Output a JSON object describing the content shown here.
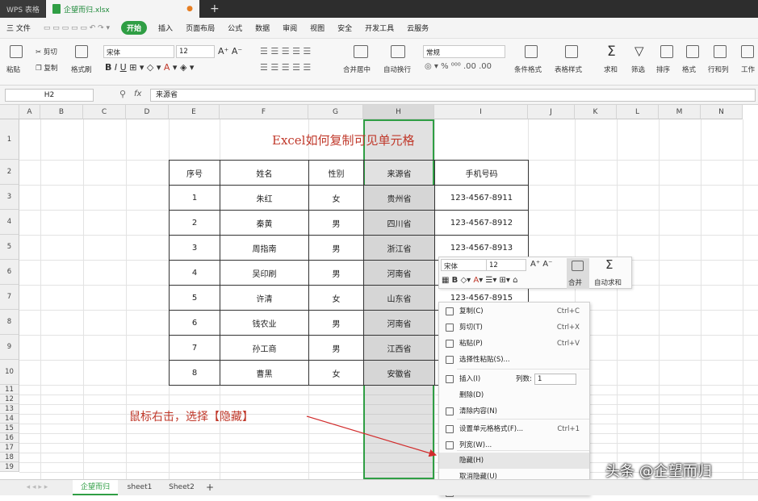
{
  "app": {
    "name": "WPS 表格",
    "file_tab": "企望而归.xlsx",
    "new_tab": "+"
  },
  "menu": {
    "file": "三 文件",
    "start": "开始",
    "items": [
      "插入",
      "页面布局",
      "公式",
      "数据",
      "审阅",
      "视图",
      "安全",
      "开发工具",
      "云服务"
    ]
  },
  "ribbon": {
    "paste": "粘贴",
    "cut": "剪切",
    "copy": "复制",
    "format_painter": "格式刷",
    "font_name": "宋体",
    "font_size": "12",
    "merge": "合并居中",
    "wrap": "自动换行",
    "number_format": "常规",
    "cond_format": "条件格式",
    "table_style": "表格样式",
    "sum": "求和",
    "filter": "筛选",
    "sort": "排序",
    "format": "格式",
    "rowcol": "行和列",
    "worksheet": "工作"
  },
  "formula_bar": {
    "cell_ref": "H2",
    "fx": "fx",
    "value": "来源省"
  },
  "columns": [
    "A",
    "B",
    "C",
    "D",
    "E",
    "F",
    "G",
    "H",
    "I",
    "J",
    "K",
    "L",
    "M",
    "N"
  ],
  "rows": [
    "1",
    "2",
    "3",
    "4",
    "5",
    "6",
    "7",
    "8",
    "9",
    "10",
    "11",
    "12",
    "13",
    "14",
    "15",
    "16",
    "17",
    "18",
    "19"
  ],
  "sheet_title": "Excel如何复制可见单元格",
  "table": {
    "headers": [
      "序号",
      "姓名",
      "性别",
      "来源省",
      "手机号码"
    ],
    "rows": [
      [
        "1",
        "朱红",
        "女",
        "贵州省",
        "123-4567-8911"
      ],
      [
        "2",
        "秦黄",
        "男",
        "四川省",
        "123-4567-8912"
      ],
      [
        "3",
        "周指南",
        "男",
        "浙江省",
        "123-4567-8913"
      ],
      [
        "4",
        "吴印刷",
        "男",
        "河南省",
        ""
      ],
      [
        "5",
        "许清",
        "女",
        "山东省",
        "123-4567-8915"
      ],
      [
        "6",
        "钱农业",
        "男",
        "河南省",
        ""
      ],
      [
        "7",
        "孙工商",
        "男",
        "江西省",
        ""
      ],
      [
        "8",
        "曹黑",
        "女",
        "安徽省",
        ""
      ]
    ]
  },
  "mini_toolbar": {
    "font": "宋体",
    "size": "12",
    "merge": "合并",
    "autosum": "自动求和"
  },
  "context_menu": [
    {
      "label": "复制(C)",
      "shortcut": "Ctrl+C"
    },
    {
      "label": "剪切(T)",
      "shortcut": "Ctrl+X"
    },
    {
      "label": "粘贴(P)",
      "shortcut": "Ctrl+V"
    },
    {
      "label": "选择性粘贴(S)...",
      "shortcut": ""
    },
    {
      "label": "插入(I)",
      "shortcut": ""
    },
    {
      "label": "删除(D)",
      "shortcut": ""
    },
    {
      "label": "清除内容(N)",
      "shortcut": ""
    },
    {
      "label": "设置单元格格式(F)...",
      "shortcut": "Ctrl+1"
    },
    {
      "label": "列宽(W)...",
      "shortcut": ""
    },
    {
      "label": "隐藏(H)",
      "shortcut": ""
    },
    {
      "label": "取消隐藏(U)",
      "shortcut": ""
    },
    {
      "label": "筛选列",
      "shortcut": ""
    }
  ],
  "insert_count": {
    "label": "列数:",
    "value": "1"
  },
  "annotation": "鼠标右击，选择【隐藏】",
  "sheets": [
    "企望而归",
    "sheet1",
    "Sheet2"
  ],
  "watermark": "头条 @企望而归",
  "colors": {
    "accent": "#2f9e44",
    "title_red": "#c0392b"
  }
}
